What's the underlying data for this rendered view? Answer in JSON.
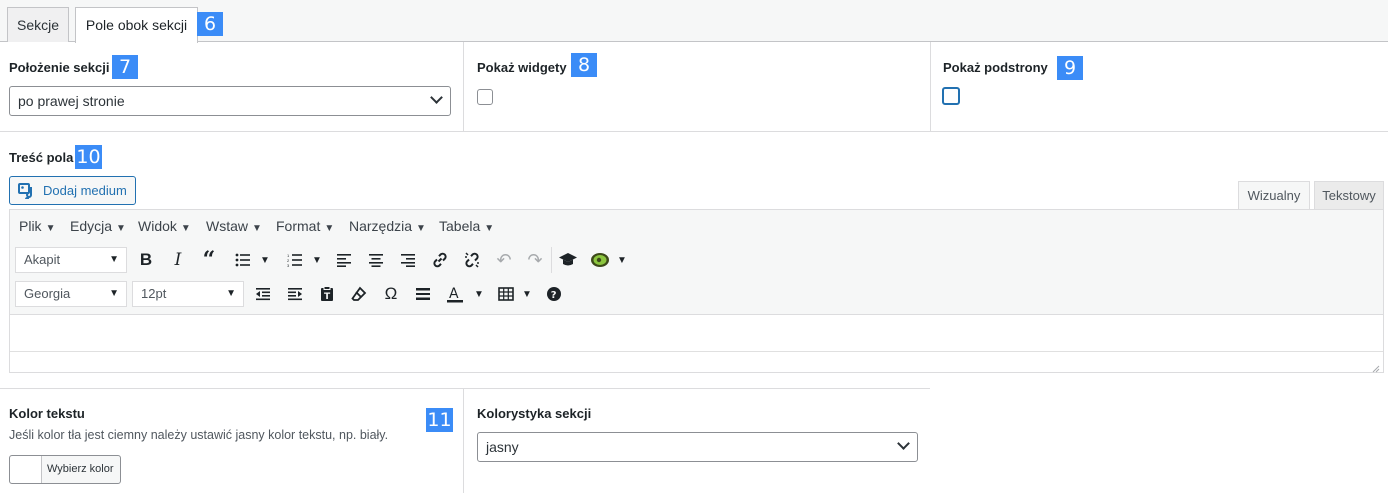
{
  "tabs": [
    {
      "label": "Sekcje"
    },
    {
      "label": "Pole obok sekcji"
    }
  ],
  "badges": [
    "6",
    "7",
    "8",
    "9",
    "10",
    "11"
  ],
  "position": {
    "label": "Położenie sekcji",
    "value": "po prawej stronie"
  },
  "widgets": {
    "label": "Pokaż widgety",
    "checked": false
  },
  "subpages": {
    "label": "Pokaż podstrony",
    "checked": false
  },
  "content": {
    "label": "Treść pola",
    "add_media": "Dodaj medium",
    "view_tabs": {
      "visual": "Wizualny",
      "text": "Tekstowy"
    },
    "menu": [
      "Plik",
      "Edycja",
      "Widok",
      "Wstaw",
      "Format",
      "Narzędzia",
      "Tabela"
    ],
    "format_select": "Akapit",
    "font_select": "Georgia",
    "size_select": "12pt"
  },
  "text_color": {
    "label": "Kolor tekstu",
    "description": "Jeśli kolor tła jest ciemny należy ustawić jasny kolor tekstu, np. biały.",
    "button": "Wybierz kolor"
  },
  "color_scheme": {
    "label": "Kolorystyka sekcji",
    "value": "jasny"
  },
  "colors": {
    "accent": "#2271b1",
    "badge": "#3b8cf7",
    "border": "#dcdcde"
  }
}
